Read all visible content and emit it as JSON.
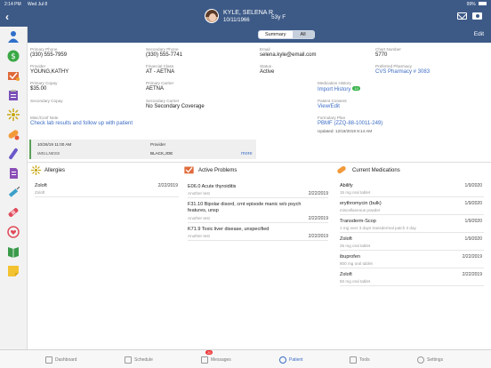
{
  "status": {
    "time": "2:14 PM",
    "date": "Wed Jul 8",
    "battery": "99%"
  },
  "header": {
    "name": "KYLE, SELENA R",
    "dob": "10/11/1966",
    "age_sex": "53y F"
  },
  "toolbar": {
    "tab_summary": "Summary",
    "tab_all": "All",
    "edit": "Edit"
  },
  "info": {
    "primary_phone_label": "Primary Phone",
    "primary_phone": "(330) 555-7959",
    "secondary_phone_label": "Secondary Phone",
    "secondary_phone": "(330) 555-7741",
    "email_label": "Email",
    "email": "selena.kyle@email.com",
    "chart_label": "Chart Number",
    "chart": "5770",
    "provider_label": "Provider",
    "provider": "YOUNG,KATHY",
    "fin_class_label": "Financial Class",
    "fin_class": "AT - AETNA",
    "status_label": "Status",
    "status": "Active",
    "pharmacy_label": "Preferred Pharmacy",
    "pharmacy": "CVS Pharmacy # 3083",
    "copay_label": "Primary Copay",
    "copay": "$35.00",
    "prim_carrier_label": "Primary Carrier",
    "prim_carrier": "AETNA",
    "med_history_label": "Medication History",
    "med_history": "Import History",
    "med_history_badge": "10",
    "sec_copay_label": "Secondary Copay",
    "sec_carrier_label": "Secondary Carrier",
    "sec_carrier": "No Secondary Coverage",
    "consent_label": "Patient Consent",
    "consent": "View/Edit",
    "note_label": "Misc/Conf Note",
    "note": "Check lab results and follow up with patient",
    "formulary_label": "Formulary Plan",
    "formulary": "PBMF (ZZQ-88-10011-249)",
    "formulary_updated": "Updated: 12/18/2019 8:14 AM"
  },
  "appointment": {
    "datetime": "10/26/19 11:00 AM",
    "provider_label": "Provider",
    "type": "WELLNESS",
    "provider": "BLACK,JOE",
    "more": "more"
  },
  "allergies": {
    "title": "Allergies",
    "items": [
      {
        "name": "Zoloft",
        "sub": "Zoloft",
        "date": "2/22/2019"
      }
    ]
  },
  "problems": {
    "title": "Active Problems",
    "items": [
      {
        "name": "E06.0 Acute thyroiditis",
        "sub": "Another test",
        "date": "2/22/2019"
      },
      {
        "name": "F31.10 Bipolar disord, crnt episode manic w/o psych features, unsp",
        "name2": "features, unsp",
        "sub": "Another test",
        "date": "2/22/2019"
      },
      {
        "name": "K71.9 Toxic liver disease, unspecified",
        "sub": "Another test",
        "date": "2/22/2019"
      }
    ]
  },
  "medications": {
    "title": "Current Medications",
    "items": [
      {
        "name": "Abilify",
        "sub": "15 mg oral tablet",
        "date": "1/9/2020"
      },
      {
        "name": "erythromycin (bulk)",
        "sub": "miscellaneous powder",
        "date": "1/9/2020"
      },
      {
        "name": "Transderm-Scop",
        "sub": "1 mg over 3 days transdermal patch 3 day",
        "date": "1/9/2020"
      },
      {
        "name": "Zoloft",
        "sub": "25 mg oral tablet",
        "date": "1/9/2020"
      },
      {
        "name": "ibuprofen",
        "sub": "800 mg oral tablet",
        "date": "2/22/2019"
      },
      {
        "name": "Zoloft",
        "sub": "50 mg oral tablet",
        "date": "2/22/2019"
      }
    ]
  },
  "tabs": {
    "dashboard": "Dashboard",
    "schedule": "Schedule",
    "messages": "Messages",
    "messages_badge": "20",
    "patient": "Patient",
    "tools": "Tools",
    "settings": "Settings"
  },
  "colors": {
    "header": "#3d5a87",
    "link": "#3b6cc4",
    "green": "#38b24a"
  }
}
